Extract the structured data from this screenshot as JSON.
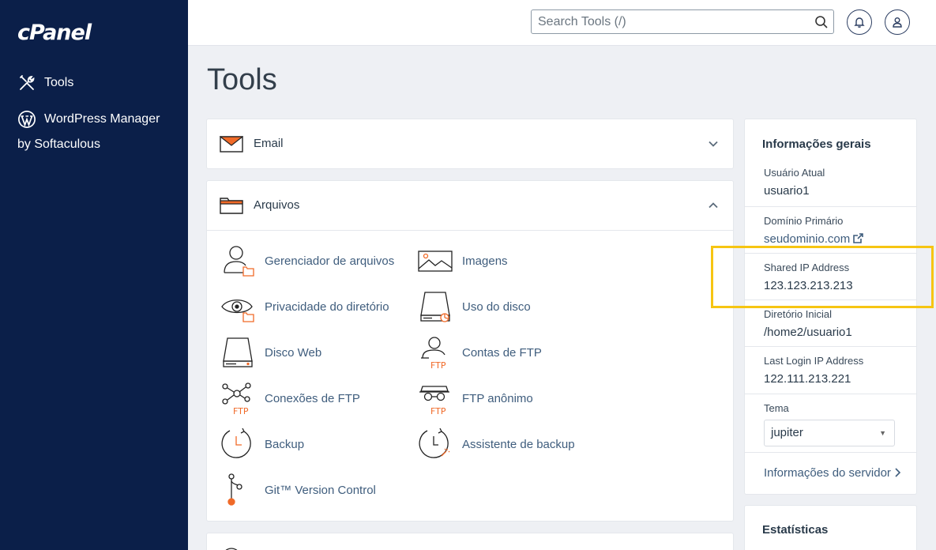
{
  "brand": {
    "logo": "cPanel"
  },
  "sidebar": {
    "items": [
      {
        "label": "Tools",
        "icon": "tools-icon"
      },
      {
        "label": "WordPress Manager",
        "sublabel": "by Softaculous",
        "icon": "wordpress-icon"
      }
    ]
  },
  "header": {
    "search_placeholder": "Search Tools (/)",
    "icons": [
      "search-icon",
      "bell-icon",
      "user-icon"
    ]
  },
  "page": {
    "title": "Tools"
  },
  "sections": [
    {
      "label": "Email",
      "icon": "envelope-icon",
      "expanded": false
    },
    {
      "label": "Arquivos",
      "icon": "folder-icon",
      "expanded": true,
      "tools": [
        {
          "label": "Gerenciador de arquivos",
          "icon": "file-manager-icon"
        },
        {
          "label": "Imagens",
          "icon": "image-icon"
        },
        {
          "label": "Privacidade do diretório",
          "icon": "eye-icon"
        },
        {
          "label": "Uso do disco",
          "icon": "disk-usage-icon"
        },
        {
          "label": "Disco Web",
          "icon": "web-disk-icon"
        },
        {
          "label": "Contas de FTP",
          "icon": "ftp-accounts-icon"
        },
        {
          "label": "Conexões de FTP",
          "icon": "ftp-connections-icon"
        },
        {
          "label": "FTP anônimo",
          "icon": "anonymous-ftp-icon"
        },
        {
          "label": "Backup",
          "icon": "backup-icon"
        },
        {
          "label": "Assistente de backup",
          "icon": "backup-wizard-icon"
        },
        {
          "label": "Git™ Version Control",
          "icon": "git-icon"
        }
      ],
      "ftp_badge": "FTP"
    }
  ],
  "info": {
    "title": "Informações gerais",
    "rows": [
      {
        "label": "Usuário Atual",
        "value": "usuario1"
      },
      {
        "label": "Domínio Primário",
        "value": "seudominio.com"
      },
      {
        "label": "Shared IP Address",
        "value": "123.123.213.213"
      },
      {
        "label": "Diretório Inicial",
        "value": "/home2/usuario1"
      },
      {
        "label": "Last Login IP Address",
        "value": "122.111.213.221"
      }
    ],
    "theme": {
      "label": "Tema",
      "selected": "jupiter"
    },
    "server_link": "Informações do servidor"
  },
  "stats": {
    "title": "Estatísticas"
  },
  "colors": {
    "sidebar": "#0b1f49",
    "accent": "#f06a28",
    "highlight": "#f6c512",
    "link": "#3f5d7d"
  }
}
